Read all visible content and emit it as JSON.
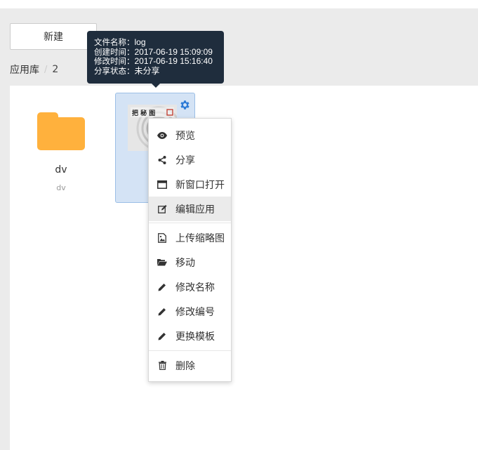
{
  "toolbar": {
    "new_label": "新建"
  },
  "breadcrumb": {
    "root": "应用库",
    "separator": "/",
    "current": "2"
  },
  "tooltip": {
    "rows": [
      {
        "label": "文件名称：",
        "value": "log"
      },
      {
        "label": "创建时间：",
        "value": "2017-06-19 15:09:09"
      },
      {
        "label": "修改时间：",
        "value": "2017-06-19 15:16:40"
      },
      {
        "label": "分享状态：",
        "value": "未分享"
      }
    ]
  },
  "folder": {
    "name": "dv",
    "subtitle": "dv",
    "color": "#ffb13d"
  },
  "app_card": {
    "gear_icon": "gear-icon",
    "accent": "#2e7bd6"
  },
  "context_menu": {
    "items": [
      {
        "label": "预览",
        "icon": "eye-icon"
      },
      {
        "label": "分享",
        "icon": "share-icon"
      },
      {
        "label": "新窗口打开",
        "icon": "window-icon"
      },
      {
        "label": "编辑应用",
        "icon": "edit-icon",
        "active": true
      },
      {
        "label": "上传缩略图",
        "icon": "image-icon"
      },
      {
        "label": "移动",
        "icon": "folder-open-icon"
      },
      {
        "label": "修改名称",
        "icon": "pencil-icon"
      },
      {
        "label": "修改编号",
        "icon": "pencil-icon"
      },
      {
        "label": "更换模板",
        "icon": "pencil-icon"
      },
      {
        "label": "删除",
        "icon": "trash-icon"
      }
    ]
  }
}
